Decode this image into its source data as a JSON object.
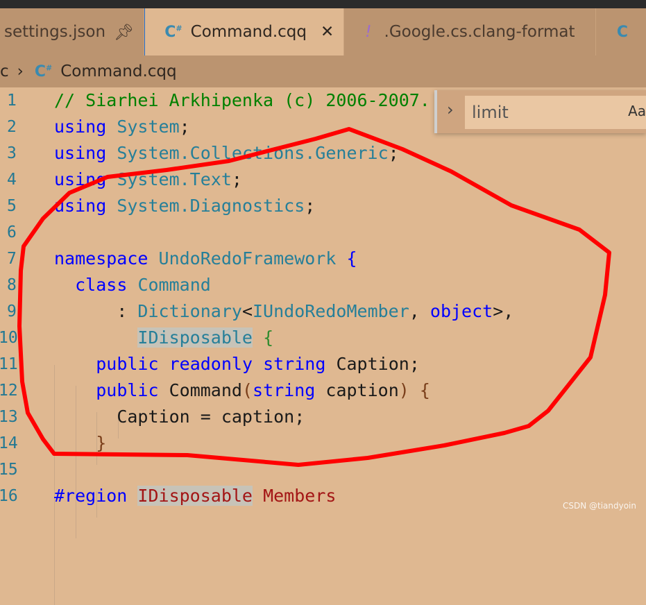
{
  "tabs": [
    {
      "label": "settings.json",
      "icon": "pin-icon"
    },
    {
      "label": "Command.cqq",
      "icon": "csharp-icon",
      "active": true
    },
    {
      "label": ".Google.cs.clang-format",
      "icon": "exclamation-icon"
    }
  ],
  "breadcrumb": {
    "prefix": "c",
    "file": "Command.cqq"
  },
  "find": {
    "value": "limit",
    "option": "Aa"
  },
  "lines": [
    "1",
    "2",
    "3",
    "4",
    "5",
    "6",
    "7",
    "8",
    "9",
    "10",
    "11",
    "12",
    "13",
    "14",
    "15",
    "16"
  ],
  "code": {
    "l1": "// Siarhei Arkhipenka (c) 2006-2007.",
    "using": "using",
    "system": "System",
    "collections": "System.Collections.Generic",
    "text": "System.Text",
    "diag": "System.Diagnostics",
    "namespace": "namespace",
    "ns": "UndoRedoFramework",
    "class": "class",
    "cls": "Command",
    "dict": "Dictionary",
    "iurm": "IUndoRedoMember",
    "object": "object",
    "idisp": "IDisposable",
    "public": "public",
    "readonly": "readonly",
    "string": "string",
    "caption_field": "Caption",
    "caption_param": "caption",
    "region": "#region",
    "members": "Members"
  },
  "colors": {
    "annotation": "#ff0000",
    "keyword": "#0000ff",
    "type": "#267f99",
    "comment": "#008000"
  },
  "watermark": "CSDN @tiandyoin"
}
